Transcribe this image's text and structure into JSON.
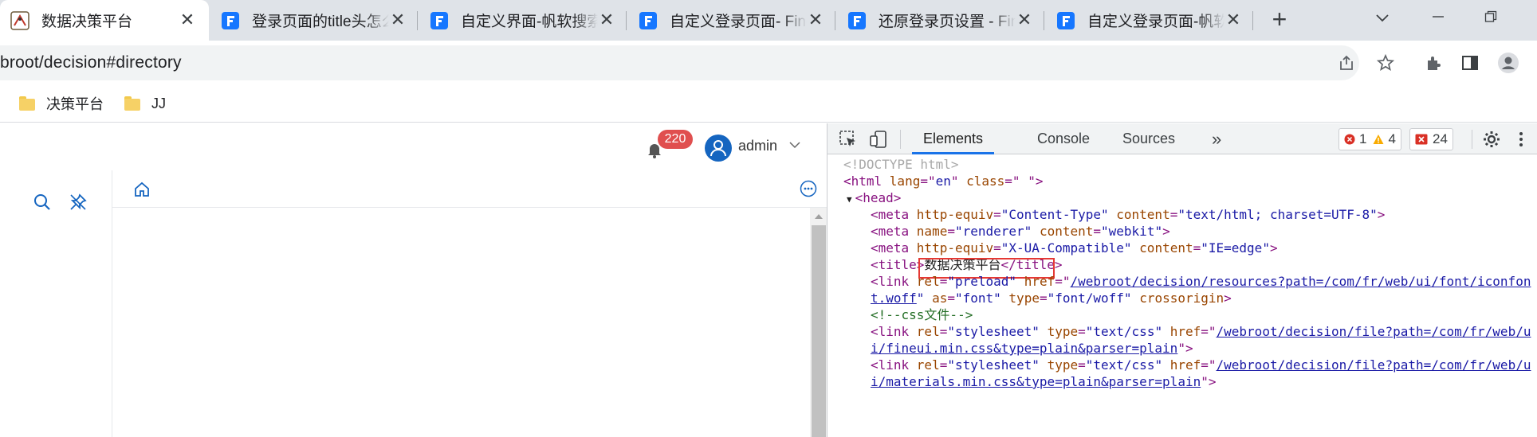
{
  "browser": {
    "tabs": [
      {
        "title": "数据决策平台",
        "active": true
      },
      {
        "title": "登录页面的title头怎么",
        "active": false
      },
      {
        "title": "自定义界面-帆软搜索",
        "active": false
      },
      {
        "title": "自定义登录页面- FineReport",
        "active": false
      },
      {
        "title": "还原登录页设置 - FineReport",
        "active": false
      },
      {
        "title": "自定义登录页面-帆软",
        "active": false
      }
    ],
    "close_glyph": "✕",
    "new_tab_glyph": "+",
    "url": "broot/decision#directory",
    "bookmarks": [
      {
        "label": "决策平台"
      },
      {
        "label": "JJ"
      }
    ]
  },
  "app": {
    "notification_count": "220",
    "username": "admin"
  },
  "devtools": {
    "tabs": [
      "Elements",
      "Console",
      "Sources"
    ],
    "more_glyph": "»",
    "errors": "1",
    "warnings": "4",
    "issues": "24",
    "code": {
      "doctype": "<!DOCTYPE html>",
      "l2_open": "<html ",
      "l2_attr1": "lang",
      "l2_eq1": "=\"",
      "l2_val1": "en",
      "l2_q1": "\" ",
      "l2_attr2": "class",
      "l2_eq2": "=\"",
      "l2_val2": " ",
      "l2_close": "\">",
      "head_arrow": "▼",
      "head": "<head>",
      "meta1_open": "<meta ",
      "meta1_a1": "http-equiv",
      "meta1_v1": "\"Content-Type\"",
      "meta1_a2": "content",
      "meta1_v2": "\"text/html; charset=UTF-8\"",
      "meta2_a1": "name",
      "meta2_v1": "\"renderer\"",
      "meta2_a2": "content",
      "meta2_v2": "\"webkit\"",
      "meta3_a1": "http-equiv",
      "meta3_v1": "\"X-UA-Compatible\"",
      "meta3_a2": "content",
      "meta3_v2": "\"IE=edge\"",
      "title_open": "<title>",
      "title_text": "数据决策平台",
      "title_close": "</title>",
      "link1_a1": "rel",
      "link1_v1": "\"preload\"",
      "link1_a2": "href",
      "link1_href": "/webroot/decision/resources?path=/com/fr/web/ui/font/iconfon",
      "link1_href2": "t.woff",
      "link1_a3": "as",
      "link1_v3": "\"font\"",
      "link1_a4": "type",
      "link1_v4": "\"font/woff\"",
      "link1_a5": "crossorigin",
      "comment": "<!--css文件-->",
      "link2_a1": "rel",
      "link2_v1": "\"stylesheet\"",
      "link2_a2": "type",
      "link2_v2": "\"text/css\"",
      "link2_a3": "href",
      "link2_href": "/webroot/decision/file?path=/com/fr/web/u",
      "link2_href2": "i/fineui.min.css&type=plain&parser=plain",
      "link3_href": "/webroot/decision/file?path=/com/fr/web/u",
      "link3_href2": "i/materials.min.css&type=plain&parser=plain"
    }
  },
  "colors": {
    "accent": "#1a73e8",
    "badge": "#e04f4f",
    "avatar": "#1565c0",
    "highlight_box": "#e53935",
    "fr_logo": "#1677ff"
  }
}
